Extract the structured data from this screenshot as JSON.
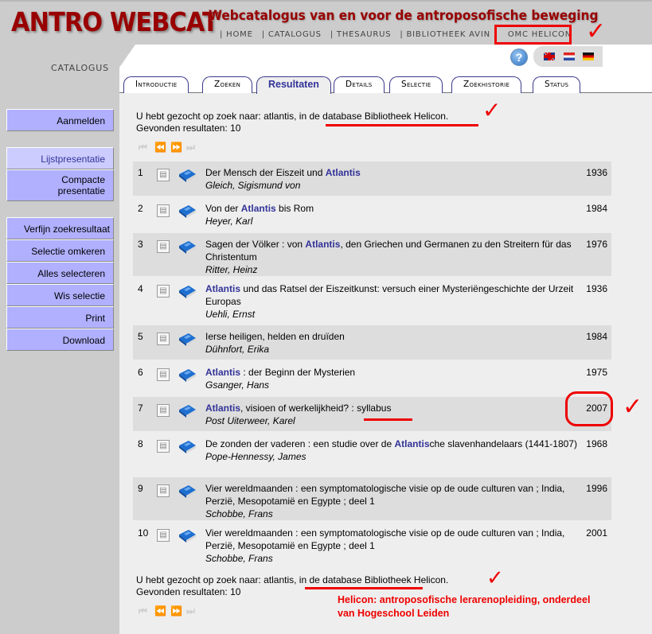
{
  "header": {
    "logo": "ANTRO WEBCAT",
    "tagline": "Webcatalogus van en voor de antroposofische beweging",
    "nav": [
      "| HOME",
      "| CATALOGUS",
      "| THESAURUS",
      "| BIBLIOTHEEK AVIN",
      "OMC HELICON"
    ],
    "section_label": "CATALOGUS",
    "help_icon": "?",
    "languages": [
      "English",
      "Nederlands",
      "Deutsch"
    ]
  },
  "tabs": [
    {
      "label": "Introductie",
      "active": false
    },
    {
      "label": "Zoeken",
      "active": false
    },
    {
      "label": "Resultaten",
      "active": true
    },
    {
      "label": "Details",
      "active": false
    },
    {
      "label": "Selectie",
      "active": false
    },
    {
      "label": "Zoekhistorie",
      "active": false
    },
    {
      "label": "Status",
      "active": false
    }
  ],
  "sidebar": {
    "login": "Aanmelden",
    "list_view": "Lijstpresentatie",
    "compact_view_1": "Compacte",
    "compact_view_2": "presentatie",
    "actions": [
      "Verfijn zoekresultaat",
      "Selectie omkeren",
      "Alles selecteren",
      "Wis selectie",
      "Print",
      "Download"
    ]
  },
  "search": {
    "summary": "U hebt gezocht op zoek naar: atlantis, in de database Bibliotheek Helicon.",
    "count": "Gevonden resultaten: 10"
  },
  "pager": {
    "first": "⏮",
    "prev": "⏪",
    "next": "⏩",
    "last": "⏭"
  },
  "results": [
    {
      "num": "1",
      "pre": "Der Mensch der Eiszeit und ",
      "hl": "Atlantis",
      "post": "",
      "author": "Gleich, Sigismund von",
      "year": "1936"
    },
    {
      "num": "2",
      "pre": "Von der ",
      "hl": "Atlantis",
      "post": " bis Rom",
      "author": "Heyer, Karl",
      "year": "1984"
    },
    {
      "num": "3",
      "pre": "Sagen der Völker : von ",
      "hl": "Atlantis",
      "post": ", den Griechen und Germanen zu den Streitern für das Christentum",
      "author": "Ritter, Heinz",
      "year": "1976"
    },
    {
      "num": "4",
      "pre": "",
      "hl": "Atlantis",
      "post": " und das Ratsel der Eiszeitkunst: versuch einer Mysteriëngeschichte der Urzeit Europas",
      "author": "Uehli, Ernst",
      "year": "1936"
    },
    {
      "num": "5",
      "pre": "Ierse heiligen, helden en druïden",
      "hl": "",
      "post": "",
      "author": "Dühnfort, Erika",
      "year": "1984"
    },
    {
      "num": "6",
      "pre": "",
      "hl": "Atlantis",
      "post": " : der Beginn der Mysterien",
      "author": "Gsanger, Hans",
      "year": "1975"
    },
    {
      "num": "7",
      "pre": "",
      "hl": "Atlantis",
      "post": ", visioen of werkelijkheid? : syllabus",
      "author": "Post Uiterweer, Karel",
      "year": "2007"
    },
    {
      "num": "8",
      "pre": "De zonden der vaderen : een studie over de ",
      "hl": "Atlantis",
      "post": "che slavenhandelaars (1441-1807)",
      "author": "Pope-Hennessy, James",
      "year": "1968"
    },
    {
      "num": "9",
      "pre": "Vier wereldmaanden : een symptomatologische visie op de oude culturen van ; India, Perzië, Mesopotamië en Egypte ; deel 1",
      "hl": "",
      "post": "",
      "author": "Schobbe, Frans",
      "year": "1996"
    },
    {
      "num": "10",
      "pre": "Vier wereldmaanden : een symptomatologische visie op de oude culturen van ; India, Perzië, Mesopotamië en Egypte ; deel 1",
      "hl": "",
      "post": "",
      "author": "Schobbe, Frans",
      "year": "2001"
    }
  ],
  "annotation": {
    "note_line1": "Helicon: antroposofische lerarenopleiding, onderdeel",
    "note_line2": "van Hogeschool Leiden",
    "check": "✓"
  },
  "colors": {
    "brand": "#990000",
    "accent": "#333399",
    "annotation": "#ee0000",
    "sidebar_button": "#b0b0ff"
  }
}
